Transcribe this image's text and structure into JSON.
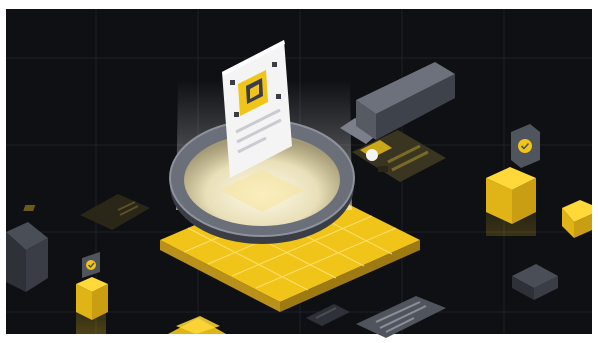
{
  "scene": {
    "background": "#0f1014",
    "grid_color": "#1d2027",
    "accent": "#f0c419",
    "accent_dark": "#b8901a",
    "panel_dark": "#3a3d45",
    "panel_mid": "#5a5e68",
    "paper": "#f4f4f4",
    "icons": [
      "magnifier-icon",
      "document-icon",
      "checkmark-badge-icon",
      "shield-badge-icon",
      "id-card-icon"
    ]
  }
}
